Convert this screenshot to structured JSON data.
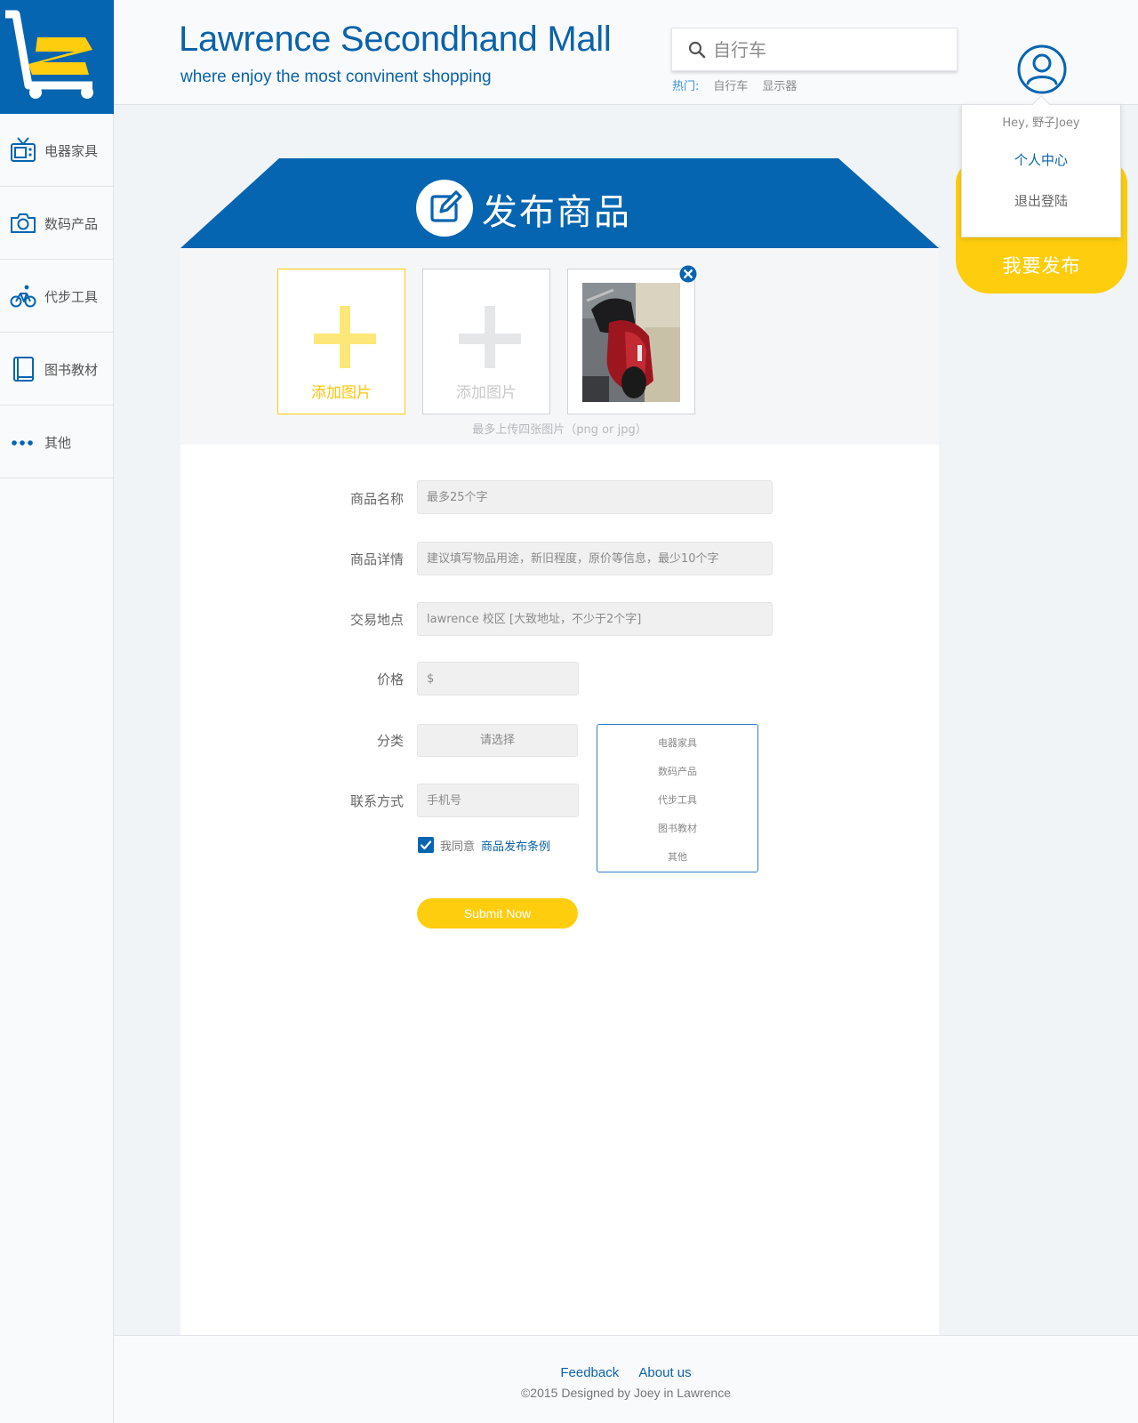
{
  "header": {
    "title": "Lawrence Secondhand Mall",
    "slogan": "where enjoy the most convinent shopping",
    "search": {
      "placeholder": "自行车"
    },
    "hot_label": "热门:",
    "hot_tags": [
      "自行车",
      "显示器"
    ]
  },
  "user_menu": {
    "greeting": "Hey, 野子Joey",
    "items": [
      "个人中心",
      "退出登陆"
    ]
  },
  "publish_button": {
    "label": "我要发布"
  },
  "sidebar": {
    "items": [
      {
        "label": "电器家具",
        "icon": "tv-icon"
      },
      {
        "label": "数码产品",
        "icon": "camera-icon"
      },
      {
        "label": "代步工具",
        "icon": "bicycle-icon"
      },
      {
        "label": "图书教材",
        "icon": "book-icon"
      },
      {
        "label": "其他",
        "icon": "more-icon"
      }
    ]
  },
  "page": {
    "title": "发布商品",
    "upload": {
      "slot_label": "添加图片",
      "hint": "最多上传四张图片（png or jpg）"
    },
    "form": {
      "name": {
        "label": "商品名称",
        "placeholder": "最多25个字"
      },
      "detail": {
        "label": "商品详情",
        "placeholder": "建议填写物品用途，新旧程度，原价等信息，最少10个字"
      },
      "location": {
        "label": "交易地点",
        "placeholder": "lawrence 校区 [大致地址，不少于2个字]"
      },
      "price": {
        "label": "价格",
        "placeholder": "$"
      },
      "category": {
        "label": "分类",
        "select_text": "请选择",
        "options": [
          "电器家具",
          "数码产品",
          "代步工具",
          "图书教材",
          "其他"
        ]
      },
      "contact": {
        "label": "联系方式",
        "placeholder": "手机号"
      },
      "agree": {
        "text": "我同意",
        "link": "商品发布条例",
        "checked": true
      },
      "submit": "Submit Now"
    }
  },
  "footer": {
    "links": [
      "Feedback",
      "About us"
    ],
    "copyright": "©2015  Designed by Joey in Lawrence"
  },
  "colors": {
    "brand_blue": "#0565b1",
    "accent_yellow": "#fecd0d"
  }
}
